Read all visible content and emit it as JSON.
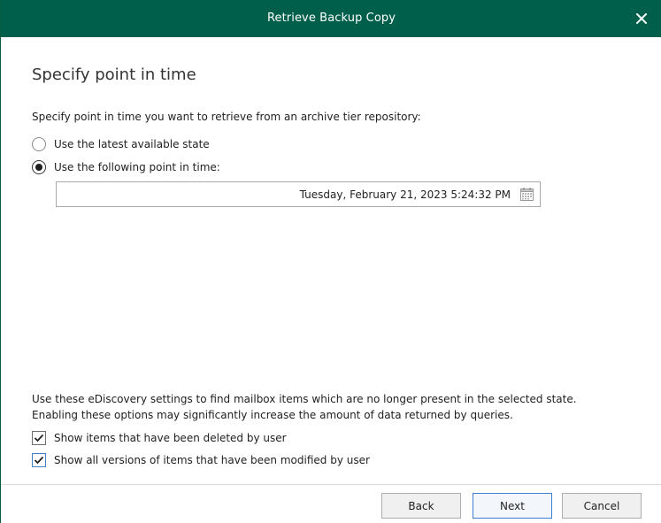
{
  "window": {
    "title": "Retrieve Backup Copy",
    "close_icon": "close-icon",
    "title_bar_color": "#005f4b"
  },
  "step": {
    "heading": "Specify point in time",
    "prompt": "Specify point in time you want to retrieve from an archive tier repository:"
  },
  "options": {
    "latest_label": "Use the latest available state",
    "latest_selected": false,
    "point_label": "Use the following point in time:",
    "point_selected": true
  },
  "datetime": {
    "value": "Tuesday, February 21, 2023 5:24:32 PM",
    "picker_icon": "calendar-icon"
  },
  "ediscovery": {
    "line1": "Use these eDiscovery settings to find mailbox items which are no longer present in the selected state.",
    "line2": "Enabling these options may significantly increase the amount of data returned by queries.",
    "deleted_label": "Show items that have been deleted by user",
    "deleted_checked": true,
    "versions_label": "Show all versions of items that have been modified by user",
    "versions_checked": true
  },
  "buttons": {
    "back": "Back",
    "next": "Next",
    "cancel": "Cancel"
  }
}
